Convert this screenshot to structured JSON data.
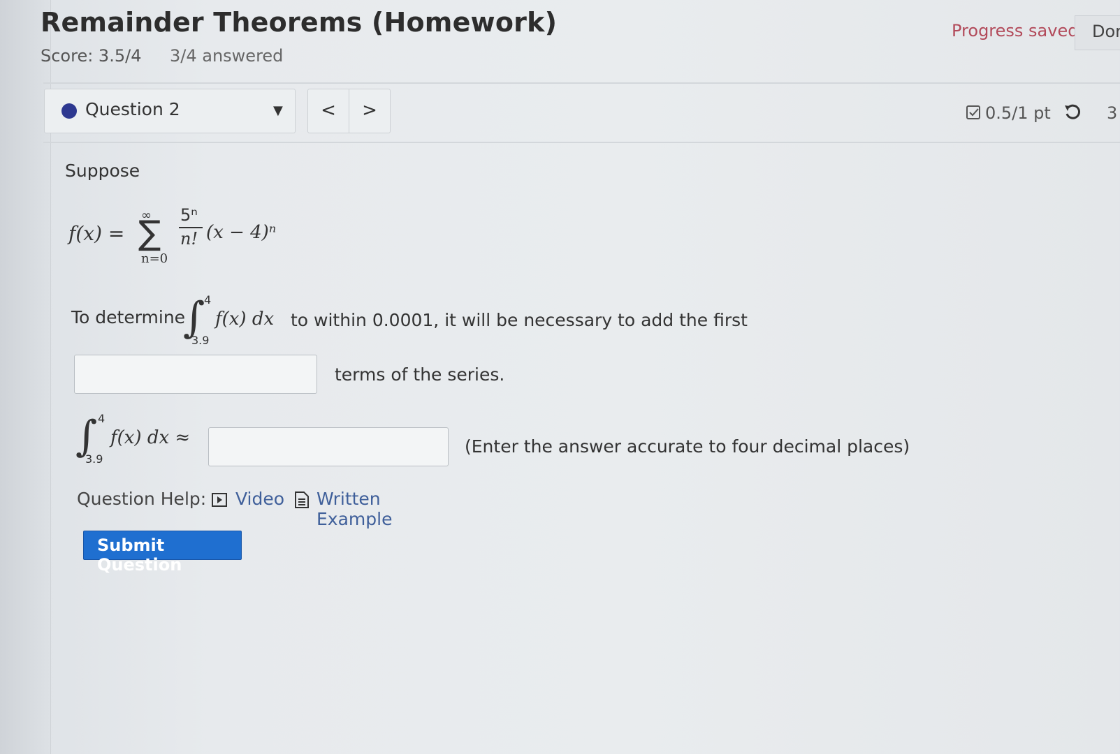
{
  "header": {
    "title": "Remainder Theorems (Homework)",
    "score": "Score: 3.5/4",
    "answered": "3/4 answered",
    "progress_status": "Progress saved",
    "done_button": "Dor"
  },
  "question_nav": {
    "selected": "Question 2",
    "prev_label": "<",
    "next_label": ">",
    "points": "0.5/1 pt",
    "retry_count": "3"
  },
  "question": {
    "suppose": "Suppose",
    "formula": {
      "lhs": "f(x) =",
      "sigma": "∑",
      "upper": "∞",
      "lower": "n=0",
      "numerator": "5ⁿ",
      "denominator": "n!",
      "tail": "(x − 4)ⁿ"
    },
    "intro": "To determine",
    "integral_upper": "4",
    "integral_lower": "3.9",
    "integrand": "f(x) dx",
    "line1_rest": "to within 0.0001, it will be necessary to add the first",
    "answer1_value": "",
    "terms_text": "terms of the series.",
    "approx_integrand": "f(x) dx ≈",
    "answer2_value": "",
    "hint": "(Enter the answer accurate to four decimal places)"
  },
  "help": {
    "label": "Question Help:",
    "video": "Video",
    "written": "Written Example"
  },
  "submit_label": "Submit Question",
  "colors": {
    "accent": "#1f6fd0",
    "progress_text": "#b24a5a",
    "question_dot": "#2d3890",
    "link": "#3f5f9a"
  },
  "icons": [
    "question-dot-icon",
    "caret-down-icon",
    "checkbox-score-icon",
    "retry-icon",
    "video-icon",
    "document-icon"
  ]
}
